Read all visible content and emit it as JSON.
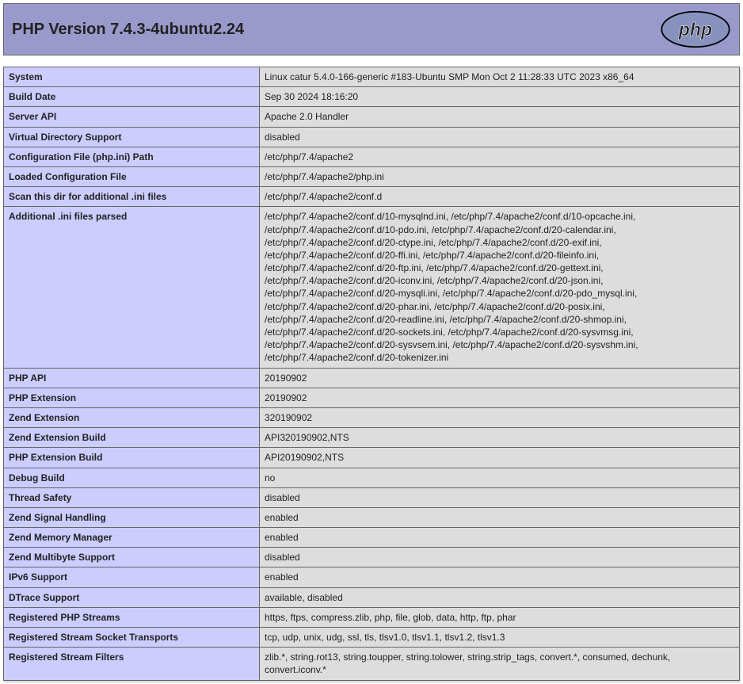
{
  "header": {
    "title": "PHP Version 7.4.3-4ubuntu2.24"
  },
  "rows": [
    {
      "key": "System",
      "val": "Linux catur 5.4.0-166-generic #183-Ubuntu SMP Mon Oct 2 11:28:33 UTC 2023 x86_64"
    },
    {
      "key": "Build Date",
      "val": "Sep 30 2024 18:16:20"
    },
    {
      "key": "Server API",
      "val": "Apache 2.0 Handler"
    },
    {
      "key": "Virtual Directory Support",
      "val": "disabled"
    },
    {
      "key": "Configuration File (php.ini) Path",
      "val": "/etc/php/7.4/apache2"
    },
    {
      "key": "Loaded Configuration File",
      "val": "/etc/php/7.4/apache2/php.ini"
    },
    {
      "key": "Scan this dir for additional .ini files",
      "val": "/etc/php/7.4/apache2/conf.d"
    },
    {
      "key": "Additional .ini files parsed",
      "val": "/etc/php/7.4/apache2/conf.d/10-mysqlnd.ini, /etc/php/7.4/apache2/conf.d/10-opcache.ini, /etc/php/7.4/apache2/conf.d/10-pdo.ini, /etc/php/7.4/apache2/conf.d/20-calendar.ini, /etc/php/7.4/apache2/conf.d/20-ctype.ini, /etc/php/7.4/apache2/conf.d/20-exif.ini, /etc/php/7.4/apache2/conf.d/20-ffi.ini, /etc/php/7.4/apache2/conf.d/20-fileinfo.ini, /etc/php/7.4/apache2/conf.d/20-ftp.ini, /etc/php/7.4/apache2/conf.d/20-gettext.ini, /etc/php/7.4/apache2/conf.d/20-iconv.ini, /etc/php/7.4/apache2/conf.d/20-json.ini, /etc/php/7.4/apache2/conf.d/20-mysqli.ini, /etc/php/7.4/apache2/conf.d/20-pdo_mysql.ini, /etc/php/7.4/apache2/conf.d/20-phar.ini, /etc/php/7.4/apache2/conf.d/20-posix.ini, /etc/php/7.4/apache2/conf.d/20-readline.ini, /etc/php/7.4/apache2/conf.d/20-shmop.ini, /etc/php/7.4/apache2/conf.d/20-sockets.ini, /etc/php/7.4/apache2/conf.d/20-sysvmsg.ini, /etc/php/7.4/apache2/conf.d/20-sysvsem.ini, /etc/php/7.4/apache2/conf.d/20-sysvshm.ini, /etc/php/7.4/apache2/conf.d/20-tokenizer.ini"
    },
    {
      "key": "PHP API",
      "val": "20190902"
    },
    {
      "key": "PHP Extension",
      "val": "20190902"
    },
    {
      "key": "Zend Extension",
      "val": "320190902"
    },
    {
      "key": "Zend Extension Build",
      "val": "API320190902,NTS"
    },
    {
      "key": "PHP Extension Build",
      "val": "API20190902,NTS"
    },
    {
      "key": "Debug Build",
      "val": "no"
    },
    {
      "key": "Thread Safety",
      "val": "disabled"
    },
    {
      "key": "Zend Signal Handling",
      "val": "enabled"
    },
    {
      "key": "Zend Memory Manager",
      "val": "enabled"
    },
    {
      "key": "Zend Multibyte Support",
      "val": "disabled"
    },
    {
      "key": "IPv6 Support",
      "val": "enabled"
    },
    {
      "key": "DTrace Support",
      "val": "available, disabled"
    },
    {
      "key": "Registered PHP Streams",
      "val": "https, ftps, compress.zlib, php, file, glob, data, http, ftp, phar"
    },
    {
      "key": "Registered Stream Socket Transports",
      "val": "tcp, udp, unix, udg, ssl, tls, tlsv1.0, tlsv1.1, tlsv1.2, tlsv1.3"
    },
    {
      "key": "Registered Stream Filters",
      "val": "zlib.*, string.rot13, string.toupper, string.tolower, string.strip_tags, convert.*, consumed, dechunk, convert.iconv.*"
    }
  ]
}
